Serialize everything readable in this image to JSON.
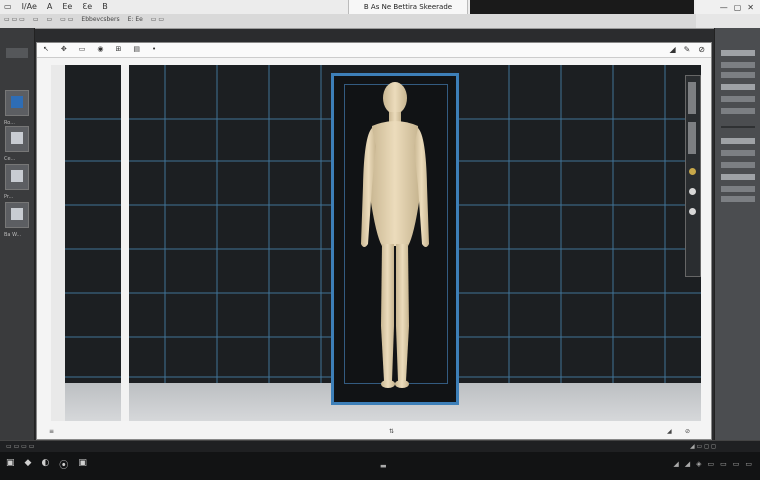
{
  "menu_bar": {
    "items": [
      "▭",
      "I/Ae",
      "A",
      "Ee",
      "Ɛe",
      "B",
      "E",
      "B"
    ],
    "title": "B As Ne Bettira Skeerade",
    "window_controls": [
      "—",
      "▢",
      "✕"
    ]
  },
  "toolbar": {
    "items": [
      "▭ ▭ ▭",
      "▭",
      "▭",
      "▭ ▭",
      "Ebbevcsbers",
      "E: Ee",
      "▭ ▭"
    ]
  },
  "canvas_toolbar": {
    "left_icons": [
      "↖",
      "✥",
      "▭",
      "◉",
      "⊞",
      "▤",
      "•"
    ],
    "right_icons": [
      "◢",
      "✎",
      "⊘"
    ]
  },
  "canvas_status": {
    "left": "≡",
    "center": "⇅",
    "right_a": "◢",
    "right_b": "⊘"
  },
  "left_panel": {
    "labels": [
      "Ro...",
      "Ce...",
      "Pr...",
      "Ba W..."
    ]
  },
  "status_bar": {
    "left": "▭ ▭ ▭ ▭",
    "right": "◢ ▭ ◻ ◻"
  },
  "timeline": {
    "buttons": [
      "▣",
      "◆",
      "◐",
      "⦿",
      "▣"
    ],
    "right": [
      "◢",
      "◢",
      "◈",
      "▭",
      "▭",
      "▭",
      "▭"
    ],
    "center": "▬"
  },
  "colors": {
    "frame_accent": "#3d7fb8",
    "grid_line": "#4d8fbf",
    "mannequin": "#e6d6b4"
  },
  "icons": {
    "canvas_select": "arrow-icon",
    "canvas_move": "move-icon",
    "mannequin": "figure-icon"
  }
}
